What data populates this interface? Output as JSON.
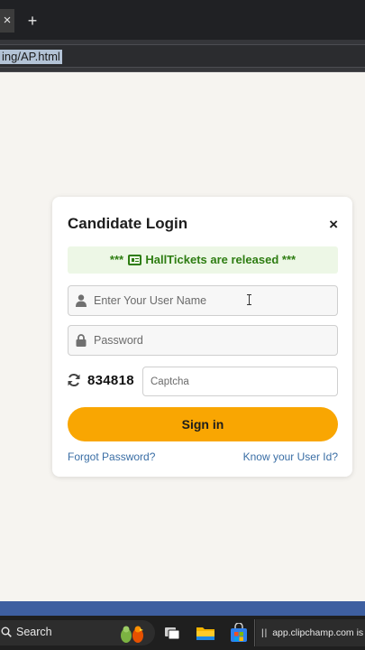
{
  "browser": {
    "tab_close_glyph": "×",
    "new_tab_glyph": "+",
    "url_text": "ing/AP.html"
  },
  "login": {
    "title": "Candidate Login",
    "close_glyph": "×",
    "notice_prefix": "***",
    "notice_text": "HallTickets are released",
    "notice_suffix": "***",
    "username_placeholder": "Enter Your User Name",
    "password_placeholder": "Password",
    "captcha_code": "834818",
    "captcha_placeholder": "Captcha",
    "signin_label": "Sign in",
    "forgot_password": "Forgot Password?",
    "know_user_id": "Know your User Id?"
  },
  "taskbar": {
    "search_label": "Search",
    "notification_text": "app.clipchamp.com is s"
  },
  "colors": {
    "accent": "#f9a602",
    "notice_green": "#2e7d12",
    "link_blue": "#3a6ea5",
    "strip_blue": "#3e5fa0"
  },
  "icons": {
    "user": "user-icon",
    "lock": "lock-icon",
    "refresh": "refresh-icon",
    "ticket": "ticket-icon",
    "search": "search-icon"
  }
}
